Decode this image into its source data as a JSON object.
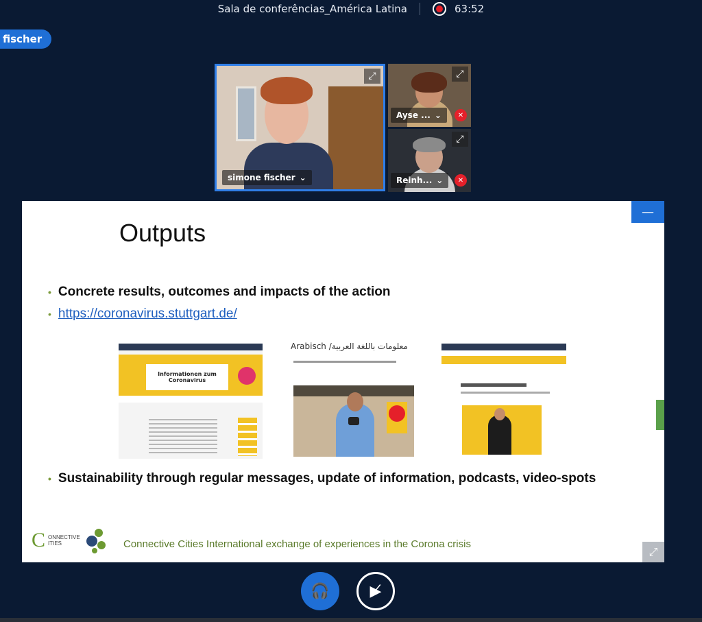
{
  "topbar": {
    "room_title": "Sala de conferências_América Latina",
    "recording_time": "63:52"
  },
  "user_pill": {
    "label": "fischer"
  },
  "participants": [
    {
      "name": "simone fischer",
      "muted": false
    },
    {
      "name": "Ayse ...",
      "muted": true
    },
    {
      "name": "Reinh...",
      "muted": true
    }
  ],
  "icons": {
    "expand": "expand-icon",
    "mute": "microphone-muted-icon",
    "chevron": "chevron-down-icon",
    "headphones": "headphones-icon",
    "camera_off": "camera-off-icon",
    "fullscreen": "fullscreen-icon",
    "minimize": "minimize-icon",
    "record": "record-icon"
  },
  "slide": {
    "title": "Outputs",
    "bullet_1": "Concrete results, outcomes and impacts of the action",
    "bullet_2_link": "https://coronavirus.stuttgart.de/",
    "bullet_3": "Sustainability through regular messages, update of information, podcasts, video-spots",
    "shot1_title_1": "Informationen zum",
    "shot1_title_2": "Coronavirus",
    "shot2_heading": "Arabisch /معلومات باللغة العربية",
    "logo_text_1": "ONNECTIVE",
    "logo_text_2": "ITIES",
    "footer": "Connective Cities International exchange of experiences in the Corona crisis"
  },
  "colors": {
    "background": "#0a1a33",
    "accent": "#1f6fd6",
    "record": "#e5202a",
    "brand_green": "#6d9a32"
  }
}
